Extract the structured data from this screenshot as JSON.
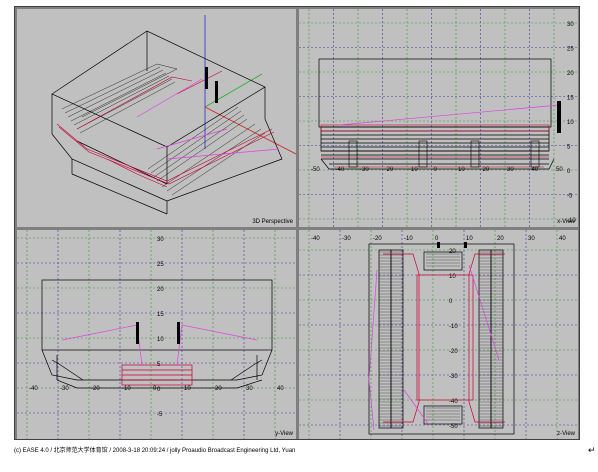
{
  "viewports": {
    "perspective": {
      "label": "3D Perspective"
    },
    "x_view": {
      "label": "x-View",
      "h_ticks": [
        "-50",
        "-40",
        "-30",
        "-20",
        "-10",
        "0",
        "10",
        "20",
        "30",
        "40",
        "50"
      ],
      "v_ticks": [
        "30",
        "25",
        "20",
        "15",
        "10",
        "5",
        "0",
        "-5",
        "-10"
      ]
    },
    "y_view": {
      "label": "y-View",
      "h_ticks": [
        "-40",
        "-30",
        "-20",
        "-10",
        "0",
        "10",
        "20",
        "30",
        "40"
      ],
      "v_ticks": [
        "30",
        "25",
        "20",
        "15",
        "10",
        "5",
        "0",
        "-5"
      ]
    },
    "z_view": {
      "label": "z-View",
      "h_ticks": [
        "-40",
        "-30",
        "-20",
        "-10",
        "0",
        "10",
        "20",
        "30",
        "40"
      ],
      "v_ticks": [
        "20",
        "10",
        "0",
        "-10",
        "-20",
        "-30",
        "-40",
        "-50"
      ]
    }
  },
  "status_bar": {
    "text": "(c) EASE 4.0  / 北京师范大学体育馆   / 2008-3-18 20:09:24  / jolly Proaudio Broadcast Engineering Ltd, Yuan"
  },
  "resize_grip": "↵",
  "colors": {
    "viewport_bg": "#c0c0c0",
    "grid_green": "#2e9a2e",
    "grid_blue": "#3c3ca0",
    "geometry": "#000000",
    "highlight": "#c80032",
    "sightline": "#e040e0"
  }
}
